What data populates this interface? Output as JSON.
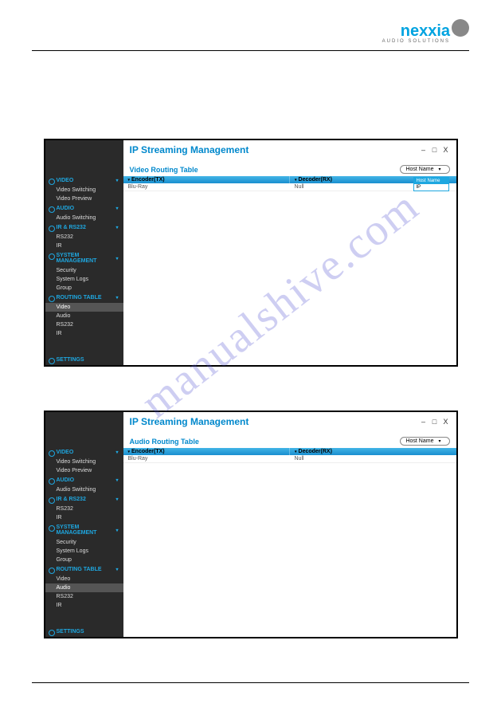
{
  "brand": {
    "name": "nexxia",
    "tagline": "AUDIO SOLUTIONS"
  },
  "watermark": "manualshive.com",
  "app_title": "IP Streaming Management",
  "win_controls": {
    "minimize": "–",
    "maximize": "□",
    "close": "X"
  },
  "host_select": {
    "label": "Host Name",
    "options": [
      "Host Name",
      "IP"
    ]
  },
  "sidebar": {
    "sections": [
      {
        "label": "VIDEO",
        "items": [
          "Video Switching",
          "Video Preview"
        ]
      },
      {
        "label": "AUDIO",
        "items": [
          "Audio Switching"
        ]
      },
      {
        "label": "IR & RS232",
        "items": [
          "RS232",
          "IR"
        ]
      },
      {
        "label": "SYSTEM MANAGEMENT",
        "items": [
          "Security",
          "System Logs",
          "Group"
        ]
      },
      {
        "label": "ROUTING TABLE",
        "items": [
          "Video",
          "Audio",
          "RS232",
          "IR"
        ]
      }
    ],
    "settings": "SETTINGS"
  },
  "screens": [
    {
      "section_title": "Video Routing Table",
      "active_sidebar": "Video",
      "show_dropdown": true,
      "columns": [
        "Encoder(TX)",
        "Decoder(RX)"
      ],
      "rows": [
        [
          "Blu-Ray",
          "Null"
        ]
      ]
    },
    {
      "section_title": "Audio Routing Table",
      "active_sidebar": "Audio",
      "show_dropdown": false,
      "columns": [
        "Encoder(TX)",
        "Decoder(RX)"
      ],
      "rows": [
        [
          "Blu-Ray",
          "Null"
        ]
      ]
    }
  ]
}
